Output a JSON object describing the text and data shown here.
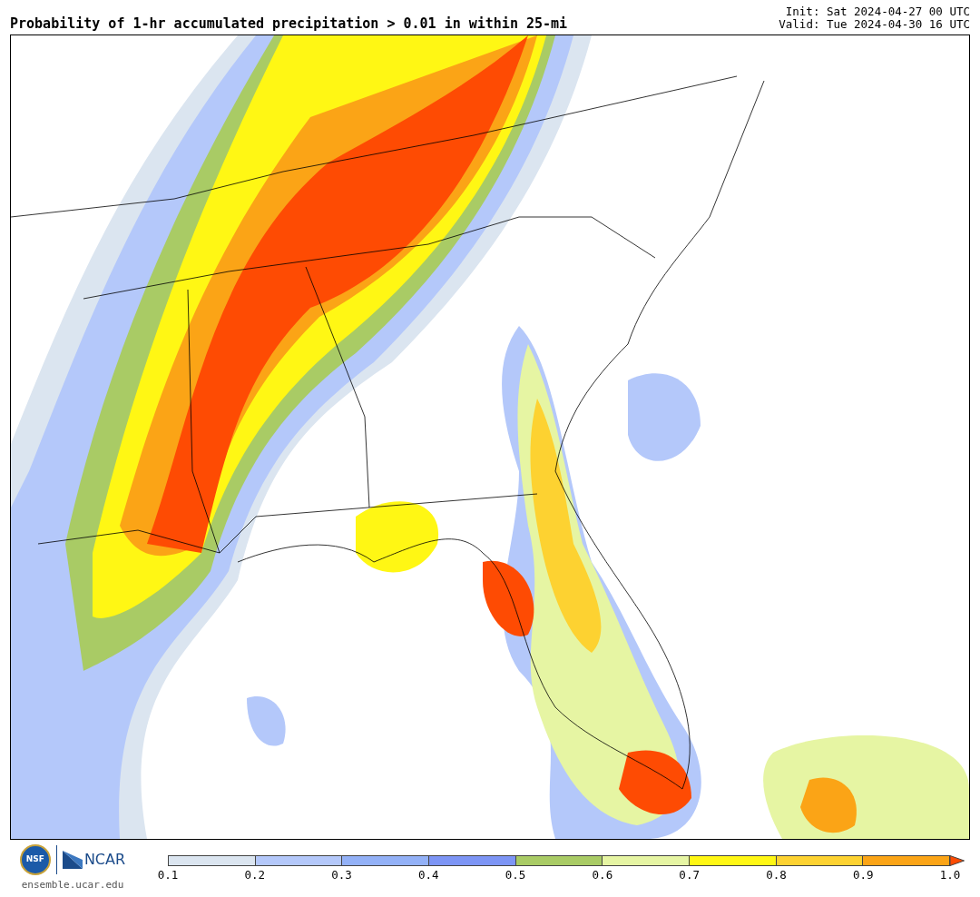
{
  "title": "Probability of 1-hr accumulated precipitation > 0.01 in within 25-mi",
  "init": "Init: Sat 2024-04-27 00 UTC",
  "valid": "Valid: Tue 2024-04-30 16 UTC",
  "logos": {
    "nsf": "NSF",
    "ncar": "NCAR",
    "site": "ensemble.ucar.edu"
  },
  "colorbar": {
    "bins": [
      {
        "color": "#dbe5f0"
      },
      {
        "color": "#b4c8fa"
      },
      {
        "color": "#93b1f7"
      },
      {
        "color": "#7d95f5"
      },
      {
        "color": "#a9cb65"
      },
      {
        "color": "#e6f5a3"
      },
      {
        "color": "#fff714"
      },
      {
        "color": "#fdd231"
      },
      {
        "color": "#fba416"
      }
    ],
    "over": {
      "color": "#fe4b03"
    },
    "ticks": [
      "0.1",
      "0.2",
      "0.3",
      "0.4",
      "0.5",
      "0.6",
      "0.7",
      "0.8",
      "0.9",
      "1.0"
    ]
  }
}
